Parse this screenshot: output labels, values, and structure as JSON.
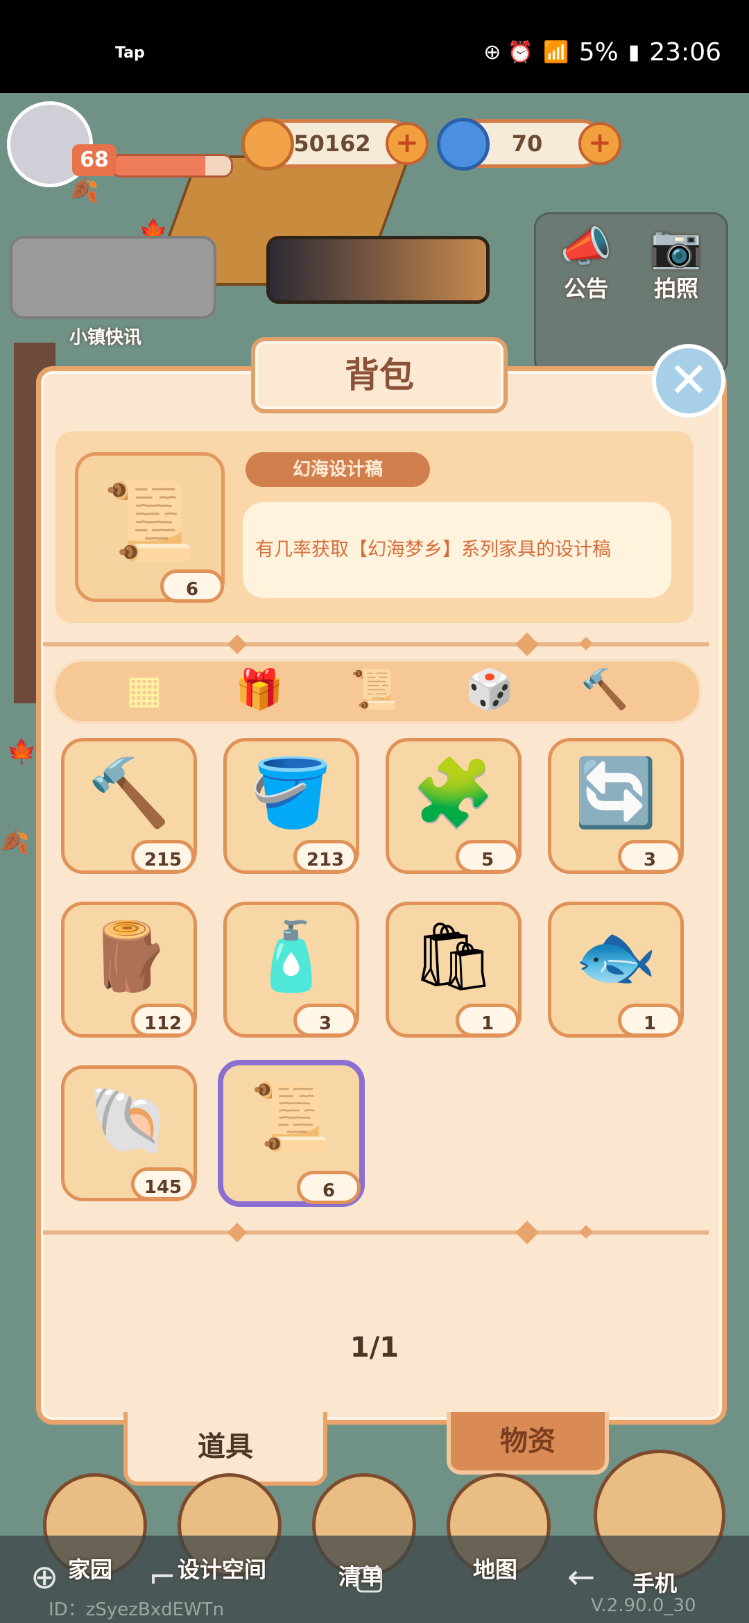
{
  "status_bar": {
    "app_label": "Tap",
    "battery": "5%",
    "time": "23:06"
  },
  "hud": {
    "level": "68",
    "xp_fraction": 0.78,
    "coins": "50162",
    "gems": "70",
    "plus_label": "+"
  },
  "town": {
    "news_label": "小镇快讯",
    "announce_label": "公告",
    "photo_label": "拍照"
  },
  "dialog": {
    "title": "背包",
    "close_label": "✕",
    "selected_item": {
      "name": "幻海设计稿",
      "description": "有几率获取【幻海梦乡】系列家具的设计稿",
      "count": "6"
    },
    "categories": [
      {
        "icon": "grid-icon",
        "glyph": "▦"
      },
      {
        "icon": "gift-box-icon",
        "glyph": "🎁"
      },
      {
        "icon": "scroll-icon",
        "glyph": "📜"
      },
      {
        "icon": "dice-icon",
        "glyph": "🎲"
      },
      {
        "icon": "hammer-icon",
        "glyph": "🔨"
      }
    ],
    "items": [
      {
        "icon": "hammer-icon",
        "glyph": "🔨",
        "count": "215"
      },
      {
        "icon": "paint-bucket-icon",
        "glyph": "🪣",
        "count": "213"
      },
      {
        "icon": "puzzle-piece-icon",
        "glyph": "🧩",
        "count": "5"
      },
      {
        "icon": "exchange-card-icon",
        "glyph": "🔄",
        "count": "3"
      },
      {
        "icon": "wood-logs-icon",
        "glyph": "🪵",
        "count": "112"
      },
      {
        "icon": "glue-bottle-icon",
        "glyph": "🧴",
        "count": "3"
      },
      {
        "icon": "sacks-icon",
        "glyph": "🛍",
        "count": "1"
      },
      {
        "icon": "fish-box-icon",
        "glyph": "🐟",
        "count": "1"
      },
      {
        "icon": "shell-icon",
        "glyph": "🐚",
        "count": "145"
      },
      {
        "icon": "design-scroll-icon",
        "glyph": "📜",
        "count": "6"
      }
    ],
    "page": "1/1",
    "tabs": {
      "active": "道具",
      "inactive": "物资"
    }
  },
  "nav": {
    "home": "家园",
    "design": "设计空间",
    "list": "清单",
    "map": "地图",
    "phone": "手机",
    "player_id": "ID：zSyezBxdEWTn",
    "version": "V.2.90.0_30"
  },
  "colors": {
    "accent": "#e9a46c",
    "panel": "#fbe6cf",
    "selected_border": "#8a6fd0"
  }
}
